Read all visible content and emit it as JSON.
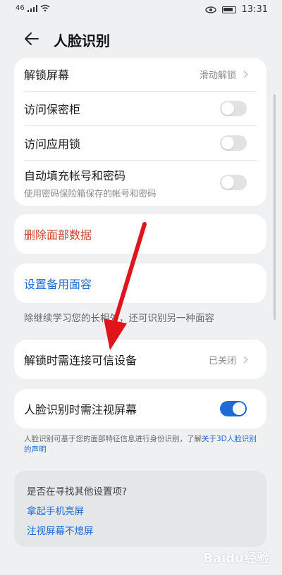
{
  "status_bar": {
    "signal": "46",
    "time": "13:31"
  },
  "header": {
    "title": "人脸识别"
  },
  "card1": {
    "unlock_screen": {
      "label": "解锁屏幕",
      "value": "滑动解锁"
    },
    "access_safe": {
      "label": "访问保密柜",
      "enabled": false
    },
    "access_applock": {
      "label": "访问应用锁",
      "enabled": false
    },
    "autofill": {
      "label": "自动填充帐号和密码",
      "sub": "使用密码保险箱保存的帐号和密码",
      "enabled": false
    }
  },
  "delete_face": {
    "label": "删除面部数据",
    "color": "#c8452a"
  },
  "alt_face": {
    "label": "设置备用面容",
    "color": "#1e6bd6"
  },
  "alt_face_note": "除继续学习您的长相外，还可识别另一种面容",
  "trusted_device": {
    "label": "解锁时需连接可信设备",
    "value": "已关闭"
  },
  "gaze": {
    "label": "人脸识别时需注视屏幕",
    "enabled": true
  },
  "statement": {
    "text": "人脸识别可基于您的面部特征信息进行身份识别，了解",
    "link": "关于3D人脸识别的声明"
  },
  "suggestions": {
    "question": "是否在寻找其他设置项?",
    "links": [
      "拿起手机亮屏",
      "注视屏幕不熄屏"
    ]
  },
  "watermark": "Baidu经验",
  "colors": {
    "accent": "#1e6bd6",
    "danger": "#c8452a",
    "arrow": "#e0151b"
  }
}
